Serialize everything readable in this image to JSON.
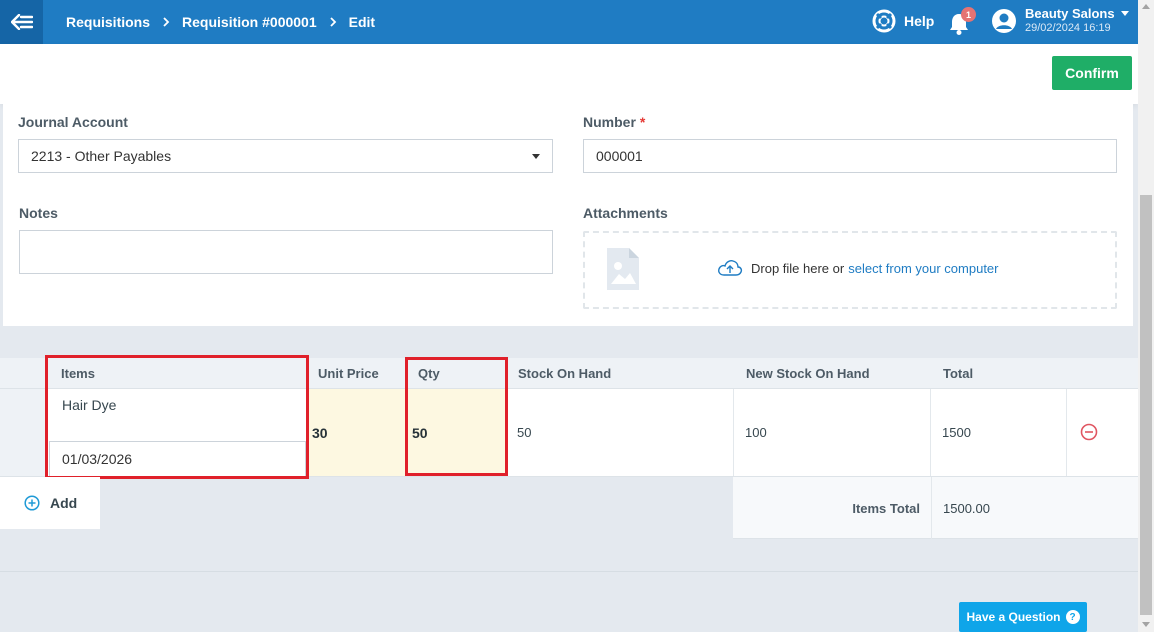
{
  "header": {
    "breadcrumbs": [
      "Requisitions",
      "Requisition #000001",
      "Edit"
    ],
    "help_label": "Help",
    "notification_count": "1",
    "user_name": "Beauty Salons",
    "user_datetime": "29/02/2024 16:19"
  },
  "toolbar": {
    "confirm_label": "Confirm"
  },
  "form": {
    "journal_account_label": "Journal Account",
    "journal_account_value": "2213 - Other Payables",
    "number_label": "Number",
    "required_mark": "*",
    "number_value": "000001",
    "notes_label": "Notes",
    "notes_value": "",
    "attachments_label": "Attachments",
    "dropzone_text": "Drop file here or",
    "dropzone_link": "select from your computer"
  },
  "items_table": {
    "headers": {
      "items": "Items",
      "unit_price": "Unit Price",
      "qty": "Qty",
      "stock_on_hand": "Stock On Hand",
      "new_stock_on_hand": "New Stock On Hand",
      "total": "Total"
    },
    "rows": [
      {
        "item": "Hair Dye",
        "date": "01/03/2026",
        "unit_price": "30",
        "qty": "50",
        "stock_on_hand": "50",
        "new_stock_on_hand": "100",
        "total": "1500"
      }
    ],
    "add_label": "Add",
    "items_total_label": "Items Total",
    "items_total_value": "1500.00"
  },
  "support": {
    "question_label": "Have a Question"
  },
  "colors": {
    "header_blue": "#1f7cc3",
    "confirm_green": "#1fae67",
    "highlight_red": "#e0202a",
    "editable_yellow": "#fdf8e1",
    "question_blue": "#0fa5e9"
  },
  "icons": [
    "back-arrow-icon",
    "chevron-right-icon",
    "lifebuoy-icon",
    "bell-icon",
    "user-avatar-icon",
    "caret-down-icon",
    "image-placeholder-icon",
    "cloud-upload-icon",
    "remove-circle-icon",
    "add-circle-icon",
    "question-icon"
  ]
}
